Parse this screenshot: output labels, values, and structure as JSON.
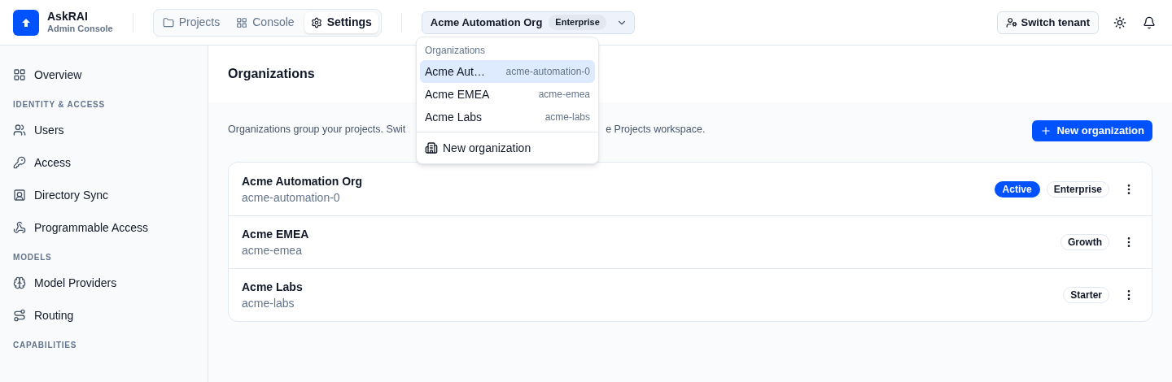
{
  "brand": {
    "name": "AskRAI",
    "subtitle": "Admin Console"
  },
  "tabs": [
    {
      "label": "Projects",
      "selected": false
    },
    {
      "label": "Console",
      "selected": false
    },
    {
      "label": "Settings",
      "selected": true
    }
  ],
  "org_selector": {
    "name": "Acme Automation Org",
    "plan": "Enterprise"
  },
  "org_menu": {
    "heading": "Organizations",
    "items": [
      {
        "name": "Acme Aut…",
        "slug": "acme-automation-0",
        "selected": true
      },
      {
        "name": "Acme EMEA",
        "slug": "acme-emea",
        "selected": false
      },
      {
        "name": "Acme Labs",
        "slug": "acme-labs",
        "selected": false
      }
    ],
    "action": "New organization"
  },
  "top_actions": {
    "switch_tenant": "Switch tenant"
  },
  "sidebar": [
    {
      "kind": "item",
      "label": "Overview"
    },
    {
      "kind": "section",
      "label": "IDENTITY & ACCESS"
    },
    {
      "kind": "item",
      "label": "Users"
    },
    {
      "kind": "item",
      "label": "Access"
    },
    {
      "kind": "item",
      "label": "Directory Sync"
    },
    {
      "kind": "item",
      "label": "Programmable Access"
    },
    {
      "kind": "section",
      "label": "MODELS"
    },
    {
      "kind": "item",
      "label": "Model Providers"
    },
    {
      "kind": "item",
      "label": "Routing"
    },
    {
      "kind": "section",
      "label": "CAPABILITIES"
    }
  ],
  "page": {
    "title": "Organizations",
    "description_start": "Organizations group your projects. Swit",
    "description_end": "e Projects workspace.",
    "new_button": "New organization"
  },
  "organizations": [
    {
      "name": "Acme Automation Org",
      "slug": "acme-automation-0",
      "active": true,
      "active_label": "Active",
      "plan": "Enterprise"
    },
    {
      "name": "Acme EMEA",
      "slug": "acme-emea",
      "active": false,
      "plan": "Growth"
    },
    {
      "name": "Acme Labs",
      "slug": "acme-labs",
      "active": false,
      "plan": "Starter"
    }
  ]
}
